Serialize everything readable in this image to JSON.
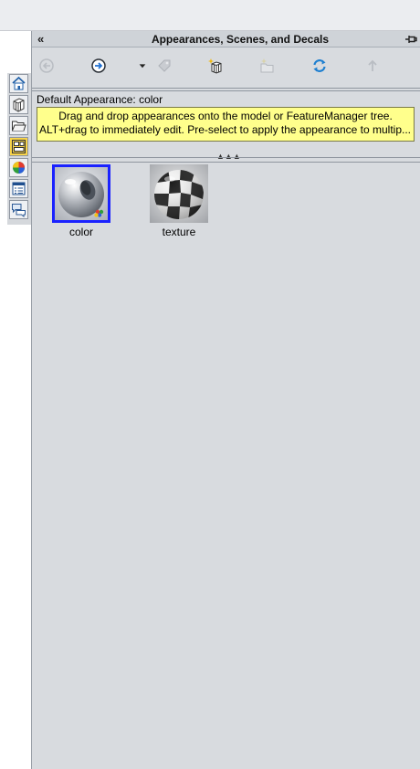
{
  "panel": {
    "title": "Appearances, Scenes, and Decals",
    "collapse_glyph": "«"
  },
  "toolbar": {
    "buttons": [
      {
        "name": "back",
        "icon": "back-arrow-icon",
        "enabled": false
      },
      {
        "name": "forward",
        "icon": "forward-arrow-icon",
        "enabled": true
      },
      {
        "name": "dropdown",
        "icon": "dropdown-arrow-icon",
        "enabled": true
      },
      {
        "name": "add-to-favorites",
        "icon": "favorites-icon",
        "enabled": false
      },
      {
        "name": "new-appearance",
        "icon": "new-appearance-icon",
        "enabled": true
      },
      {
        "name": "new-folder",
        "icon": "new-folder-icon",
        "enabled": false
      },
      {
        "name": "refresh",
        "icon": "refresh-icon",
        "enabled": true
      },
      {
        "name": "up-level",
        "icon": "up-arrow-icon",
        "enabled": false
      }
    ]
  },
  "default_appearance_label": "Default Appearance: color",
  "tooltip": {
    "line1": "Drag and drop appearances onto the model or FeatureManager tree.",
    "line2": "ALT+drag to immediately edit.  Pre-select to apply the appearance to multip..."
  },
  "side_tabs": [
    {
      "icon": "home-icon"
    },
    {
      "icon": "design-library-icon"
    },
    {
      "icon": "file-explorer-icon"
    },
    {
      "icon": "view-palette-icon"
    },
    {
      "icon": "appearances-icon"
    },
    {
      "icon": "custom-properties-icon"
    },
    {
      "icon": "forum-icon"
    }
  ],
  "thumbnails": [
    {
      "label": "color",
      "selected": true
    },
    {
      "label": "texture",
      "selected": false
    }
  ],
  "colors": {
    "selection": "#1a22ff",
    "tooltip_bg": "#ffff8c",
    "pane_bg": "#d8dbdf"
  }
}
